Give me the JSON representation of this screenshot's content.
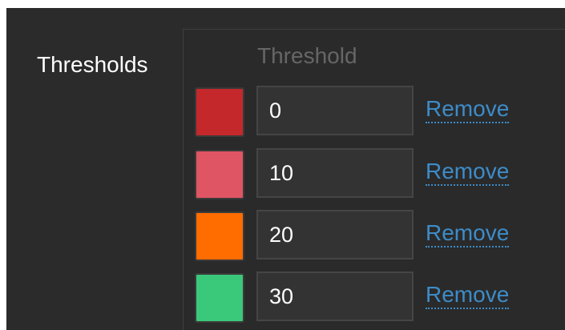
{
  "thresholds": {
    "section_label": "Thresholds",
    "column_header": "Threshold",
    "remove_label": "Remove",
    "rows": [
      {
        "color": "#c4282b",
        "value": "0"
      },
      {
        "color": "#e05563",
        "value": "10"
      },
      {
        "color": "#ff6c00",
        "value": "20"
      },
      {
        "color": "#3ac87a",
        "value": "30"
      }
    ]
  }
}
